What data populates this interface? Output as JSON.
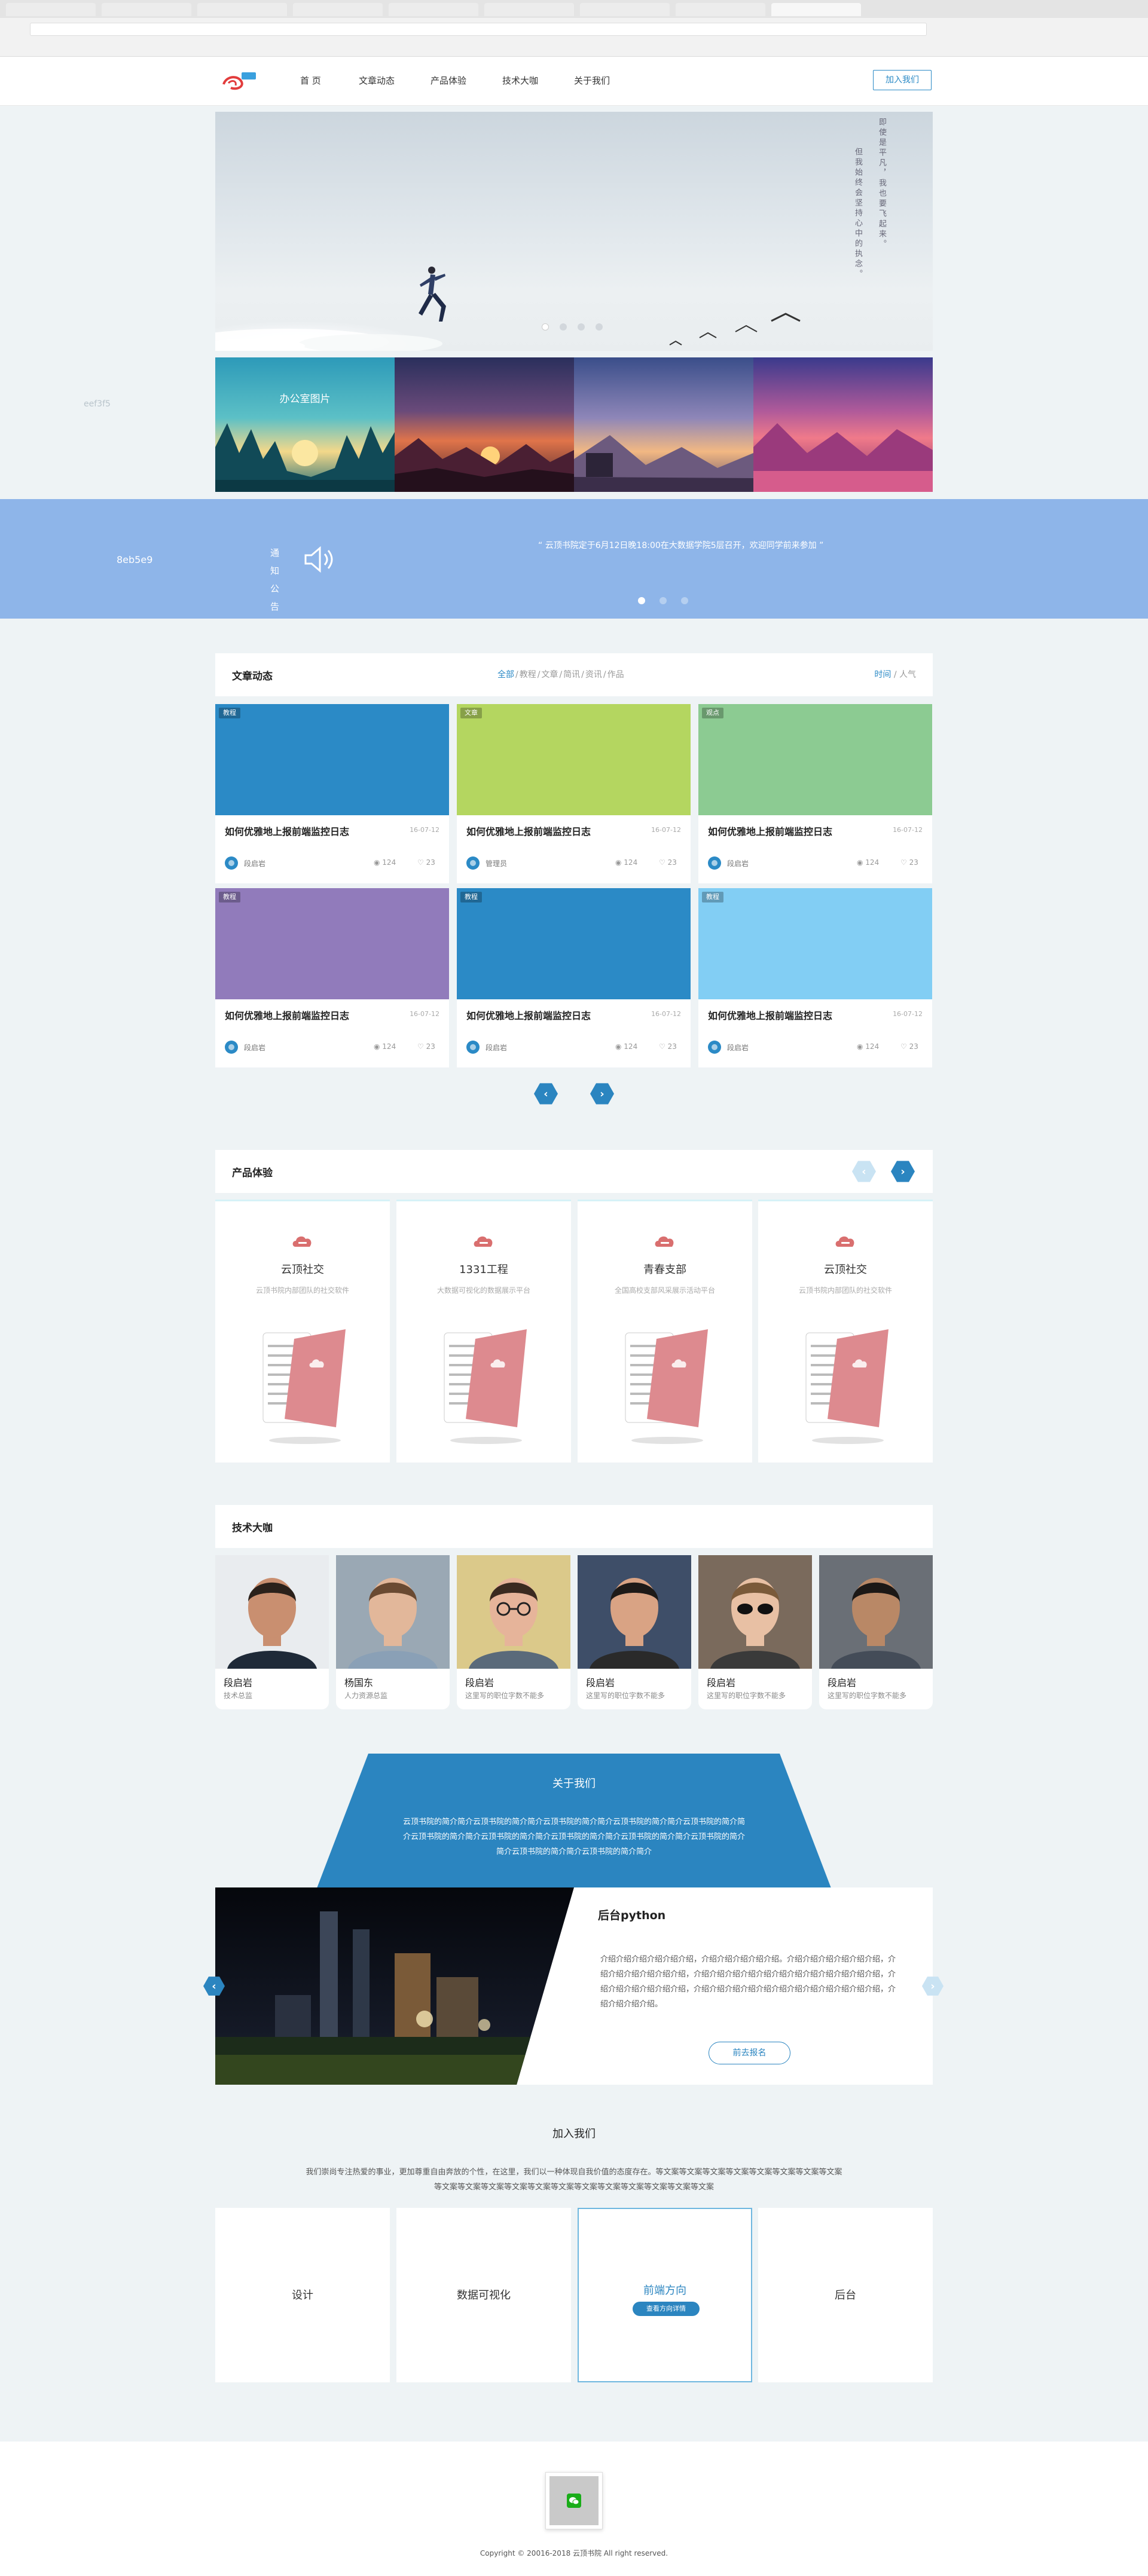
{
  "header": {
    "nav": [
      "首 页",
      "文章动态",
      "产品体验",
      "技术大咖",
      "关于我们"
    ],
    "join_button": "加入我们"
  },
  "hero": {
    "vertical_text_1": "即使是平凡，我也要飞起来。",
    "vertical_text_2": "但我始终会坚持心中的执念。"
  },
  "gallery": {
    "left_label": "eef3f5",
    "caption": "办公室图片"
  },
  "notice": {
    "color_label": "8eb5e9",
    "title": "通 知 公 告",
    "text": "“ 云顶书院定于6月12日晚18:00在大数据学院5层召开，欢迎同学前来参加 ”"
  },
  "articles": {
    "title": "文章动态",
    "filters": [
      "全部",
      "教程",
      "文章",
      "简讯",
      "资讯",
      "作品"
    ],
    "sorts": [
      "时间",
      "人气"
    ],
    "items": [
      {
        "tag": "教程",
        "title": "如何优雅地上报前端监控日志",
        "date": "16-07-12",
        "author": "段启岩",
        "views": "124",
        "likes": "23",
        "color": "#2b8ac6"
      },
      {
        "tag": "文章",
        "title": "如何优雅地上报前端监控日志",
        "date": "16-07-12",
        "author": "管理员",
        "views": "124",
        "likes": "23",
        "color": "#b4d660"
      },
      {
        "tag": "观点",
        "title": "如何优雅地上报前端监控日志",
        "date": "16-07-12",
        "author": "段启岩",
        "views": "124",
        "likes": "23",
        "color": "#8ccb92"
      },
      {
        "tag": "教程",
        "title": "如何优雅地上报前端监控日志",
        "date": "16-07-12",
        "author": "段启岩",
        "views": "124",
        "likes": "23",
        "color": "#917bbb"
      },
      {
        "tag": "教程",
        "title": "如何优雅地上报前端监控日志",
        "date": "16-07-12",
        "author": "段启岩",
        "views": "124",
        "likes": "23",
        "color": "#2b8ac6"
      },
      {
        "tag": "教程",
        "title": "如何优雅地上报前端监控日志",
        "date": "16-07-12",
        "author": "段启岩",
        "views": "124",
        "likes": "23",
        "color": "#82cef4"
      }
    ]
  },
  "products": {
    "title": "产品体验",
    "items": [
      {
        "name": "云顶社交",
        "desc": "云顶书院内部团队的社交软件"
      },
      {
        "name": "1331工程",
        "desc": "大数据可视化的数据展示平台"
      },
      {
        "name": "青春支部",
        "desc": "全国高校支部风采展示活动平台"
      },
      {
        "name": "云顶社交",
        "desc": "云顶书院内部团队的社交软件"
      }
    ]
  },
  "experts": {
    "title": "技术大咖",
    "items": [
      {
        "name": "段启岩",
        "title": "技术总监"
      },
      {
        "name": "杨国东",
        "title": "人力资源总监"
      },
      {
        "name": "段启岩",
        "title": "这里写的职位字数不能多"
      },
      {
        "name": "段启岩",
        "title": "这里写的职位字数不能多"
      },
      {
        "name": "段启岩",
        "title": "这里写的职位字数不能多"
      },
      {
        "name": "段启岩",
        "title": "这里写的职位字数不能多"
      }
    ]
  },
  "about": {
    "title": "关于我们",
    "text": "云顶书院的简介简介云顶书院的简介简介云顶书院的简介简介云顶书院的简介简介云顶书院的简介简介云顶书院的简介简介云顶书院的简介简介云顶书院的简介简介云顶书院的简介简介云顶书院的简介简介云顶书院的简介简介云顶书院的简介简介",
    "card_title": "后台python",
    "card_text": "介绍介绍介绍介绍介绍介绍，介绍介绍介绍介绍介绍。介绍介绍介绍介绍介绍介绍，介绍介绍介绍介绍介绍介绍，介绍介绍介绍介绍介绍介绍介绍介绍介绍介绍介绍介绍，介绍介绍介绍介绍介绍介绍，介绍介绍介绍介绍介绍介绍介绍介绍介绍介绍介绍介绍，介绍介绍介绍介绍。",
    "button": "前去报名"
  },
  "join": {
    "title": "加入我们",
    "text": "我们崇尚专注热爱的事业，更加尊重自由奔放的个性，在这里，我们以一种体现自我价值的态度存在。等文案等文案等文案等文案等文案等文案等文案等文案等文案等文案等文案等文案等文案等文案等文案等文案等文案等文案等文案等文案",
    "directions": [
      "设计",
      "数据可视化",
      "前端方向",
      "后台"
    ],
    "badge": "查看方向详情"
  },
  "footer": {
    "copyright": "Copyright © 20016-2018 云顶书院 All right reserved."
  }
}
